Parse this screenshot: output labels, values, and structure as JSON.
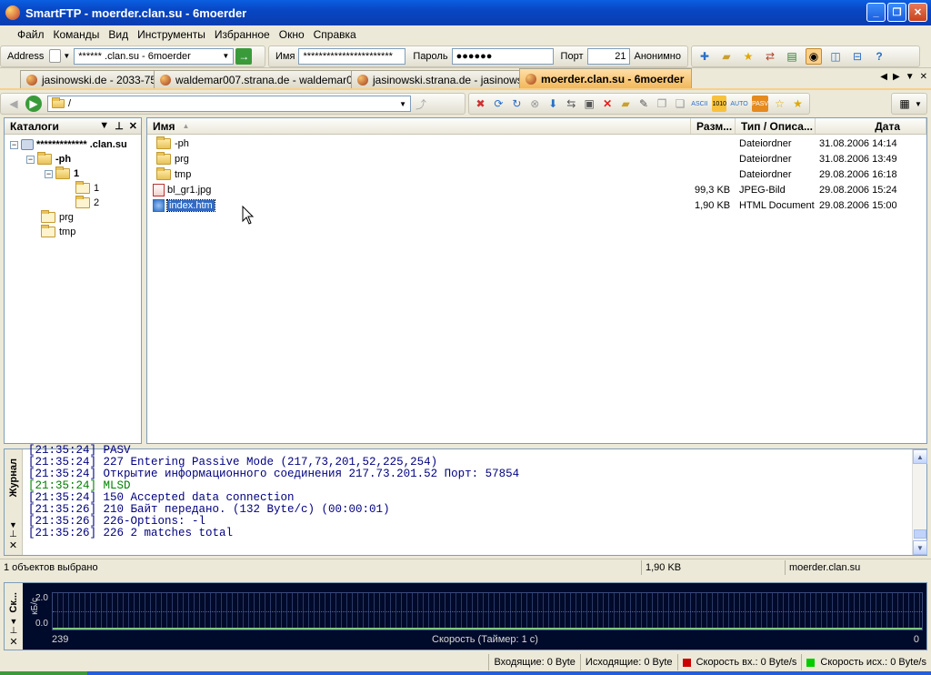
{
  "window": {
    "title": "SmartFTP - moerder.clan.su - 6moerder"
  },
  "menu": [
    "Файл",
    "Команды",
    "Вид",
    "Инструменты",
    "Избранное",
    "Окно",
    "Справка"
  ],
  "quickconnect": {
    "address_label": "Address",
    "address_value": "******    .clan.su - 6moerder",
    "name_label": "Имя",
    "name_value": "***********************",
    "password_label": "Пароль",
    "password_value": "●●●●●●",
    "port_label": "Порт",
    "port_value": "21",
    "anon_label": "Анонимно"
  },
  "tabs": [
    {
      "label": "jasinowski.de - 2033-759",
      "active": false
    },
    {
      "label": "waldemar007.strana.de - waldemar007",
      "active": false
    },
    {
      "label": "jasinowski.strana.de - jasinowsk",
      "active": false
    },
    {
      "label": "moerder.clan.su - 6moerder",
      "active": true
    }
  ],
  "path": {
    "value": "/"
  },
  "tree": {
    "title": "Каталоги",
    "nodes": [
      {
        "label": "*************  .clan.su",
        "bold": true
      },
      {
        "label": "-ph",
        "bold": true
      },
      {
        "label": "1",
        "bold": true
      },
      {
        "label": "1",
        "bold": false
      },
      {
        "label": "2",
        "bold": false
      },
      {
        "label": "prg",
        "bold": false
      },
      {
        "label": "tmp",
        "bold": false
      }
    ]
  },
  "files": {
    "headers": {
      "name": "Имя",
      "size": "Разм...",
      "type": "Тип / Описа...",
      "date": "Дата"
    },
    "rows": [
      {
        "name": "-ph",
        "size": "",
        "type": "Dateiordner",
        "date": "31.08.2006 14:14",
        "icon": "folder-icon"
      },
      {
        "name": "prg",
        "size": "",
        "type": "Dateiordner",
        "date": "31.08.2006 13:49",
        "icon": "folder-icon"
      },
      {
        "name": "tmp",
        "size": "",
        "type": "Dateiordner",
        "date": "29.08.2006 16:18",
        "icon": "folder-icon"
      },
      {
        "name": "bl_gr1.jpg",
        "size": "99,3 KB",
        "type": "JPEG-Bild",
        "date": "29.08.2006 15:24",
        "icon": "jpeg-file-icon"
      },
      {
        "name": "index.htm",
        "size": "1,90 KB",
        "type": "HTML Document",
        "date": "29.08.2006 15:00",
        "icon": "html-file-icon",
        "selected": true
      }
    ]
  },
  "log": {
    "title": "Журнал",
    "lines": [
      {
        "text": "[21:35:24] PASV",
        "color": "#000080"
      },
      {
        "text": "[21:35:24] 227 Entering Passive Mode (217,73,201,52,225,254)",
        "color": "#000080"
      },
      {
        "text": "[21:35:24] Открытие информационного соединения 217.73.201.52 Порт: 57854",
        "color": "#000080"
      },
      {
        "text": "[21:35:24] MLSD",
        "color": "#008000"
      },
      {
        "text": "[21:35:24] 150 Accepted data connection",
        "color": "#000080"
      },
      {
        "text": "[21:35:26] 210 Байт передано. (132 Byte/c) (00:00:01)",
        "color": "#000080"
      },
      {
        "text": "[21:35:26] 226-Options: -l",
        "color": "#000080"
      },
      {
        "text": "[21:35:26] 226 2 matches total",
        "color": "#000080"
      }
    ]
  },
  "status": {
    "selected": "1 объектов выбрано",
    "size": "1,90 KB",
    "host": "moerder.clan.su"
  },
  "graph": {
    "side_label": "Ск...",
    "y_unit": "кБ/с",
    "y_top": "2.0",
    "y_bottom": "0.0",
    "x_left": "239",
    "x_right": "0",
    "caption": "Скорость (Таймер: 1 с)",
    "in_color": "#cc0000",
    "out_color": "#00cc00"
  },
  "transfer": {
    "incoming": "Входящие: 0 Byte",
    "outgoing": "Исходящие: 0 Byte",
    "speed_in": "Скорость вх.: 0 Byte/s",
    "speed_out": "Скорость исх.: 0 Byte/s"
  }
}
